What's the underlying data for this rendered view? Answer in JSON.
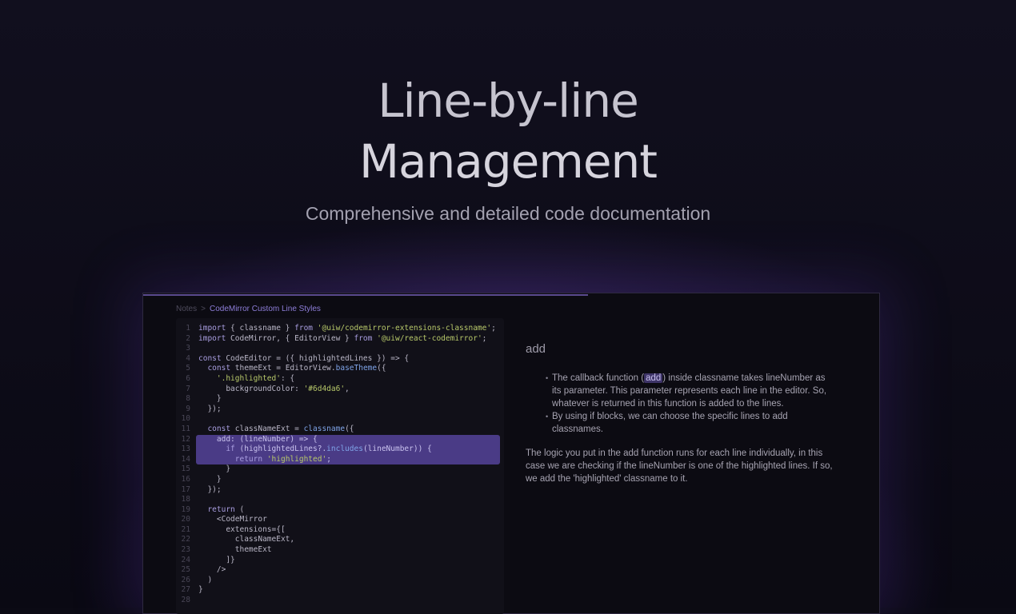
{
  "hero": {
    "title_line1": "Line-by-line",
    "title_line2": "Management",
    "subtitle": "Comprehensive and detailed code documentation"
  },
  "breadcrumb": {
    "root": "Notes",
    "separator": ">",
    "current": "CodeMirror Custom Line Styles"
  },
  "code": {
    "highlighted_lines": [
      12,
      13,
      14
    ],
    "lines": [
      "import { classname } from '@uiw/codemirror-extensions-classname';",
      "import CodeMirror, { EditorView } from '@uiw/react-codemirror';",
      "",
      "const CodeEditor = ({ highlightedLines }) => {",
      "  const themeExt = EditorView.baseTheme({",
      "    '.highlighted': {",
      "      backgroundColor: '#6d4da6',",
      "    }",
      "  });",
      "",
      "  const classNameExt = classname({",
      "    add: (lineNumber) => {",
      "      if (highlightedLines?.includes(lineNumber)) {",
      "        return 'highlighted';",
      "      }",
      "    }",
      "  });",
      "",
      "  return (",
      "    <CodeMirror",
      "      extensions={[",
      "        classNameExt,",
      "        themeExt",
      "      ]}",
      "    />",
      "  )",
      "}",
      ""
    ]
  },
  "notes": {
    "heading": "add",
    "bullet1_before": "The callback function (",
    "bullet1_code": "add",
    "bullet1_after": ") inside classname takes lineNumber as its parameter. This parameter represents each line in the editor. So, whatever is returned in this function is added to the lines.",
    "bullet2": "By using if blocks, we can choose the specific lines to add classnames.",
    "paragraph": "The logic you put in the add function runs for each line individually, in this case we are checking if the lineNumber is one of the highlighted lines. If so, we add the 'highlighted' classname to it."
  },
  "colors": {
    "background": "#0b0a14",
    "highlight": "#4a3b86",
    "accent": "#8e7ed9"
  }
}
